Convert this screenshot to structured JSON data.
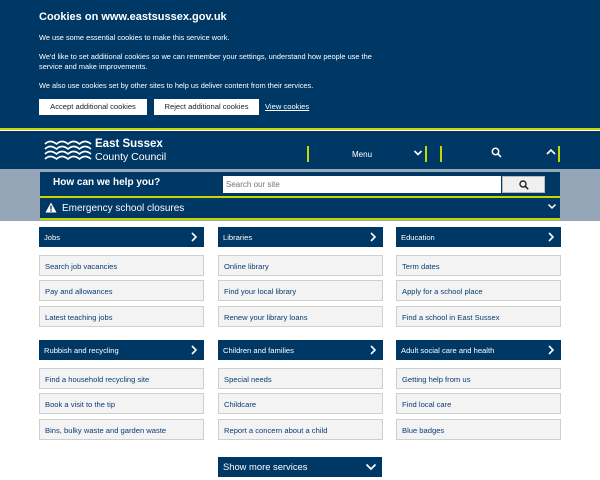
{
  "cookie_banner": {
    "title": "Cookies on www.eastsussex.gov.uk",
    "paragraph1": "We use some essential cookies to make this service work.",
    "paragraph2": "We'd like to set additional cookies so we can remember your settings, understand how people use the service and make improvements.",
    "paragraph3": "We also use cookies set by other sites to help us deliver content from their services.",
    "accept_label": "Accept additional cookies",
    "reject_label": "Reject additional cookies",
    "view_label": "View cookies"
  },
  "header": {
    "brand_line1": "East Sussex",
    "brand_line2": "County Council",
    "menu_label": "Menu",
    "icons": [
      "east-sussex-logo-icon",
      "chevron-down-icon",
      "search-icon",
      "chevron-up-icon"
    ]
  },
  "search": {
    "prompt": "How can we help you?",
    "placeholder": "Search our site"
  },
  "alert": {
    "label": "Emergency school closures"
  },
  "services": [
    {
      "heading": "Jobs",
      "links": [
        "Search job vacancies",
        "Pay and allowances",
        "Latest teaching jobs"
      ]
    },
    {
      "heading": "Libraries",
      "links": [
        "Online library",
        "Find your local library",
        "Renew your library loans"
      ]
    },
    {
      "heading": "Education",
      "links": [
        "Term dates",
        "Apply for a school place",
        "Find a school in East Sussex"
      ]
    },
    {
      "heading": "Rubbish and recycling",
      "links": [
        "Find a household recycling site",
        "Book a visit to the tip",
        "Bins, bulky waste and garden waste"
      ]
    },
    {
      "heading": "Children and families",
      "links": [
        "Special needs",
        "Childcare",
        "Report a concern about a child"
      ]
    },
    {
      "heading": "Adult social care and health",
      "links": [
        "Getting help from us",
        "Find local care",
        "Blue badges"
      ]
    }
  ],
  "show_more": {
    "label": "Show more services"
  },
  "colors": {
    "navy": "#003865",
    "accent_yellow": "#c6d600",
    "band_grey": "#94a6b7",
    "link_bg": "#f3f3f3"
  }
}
